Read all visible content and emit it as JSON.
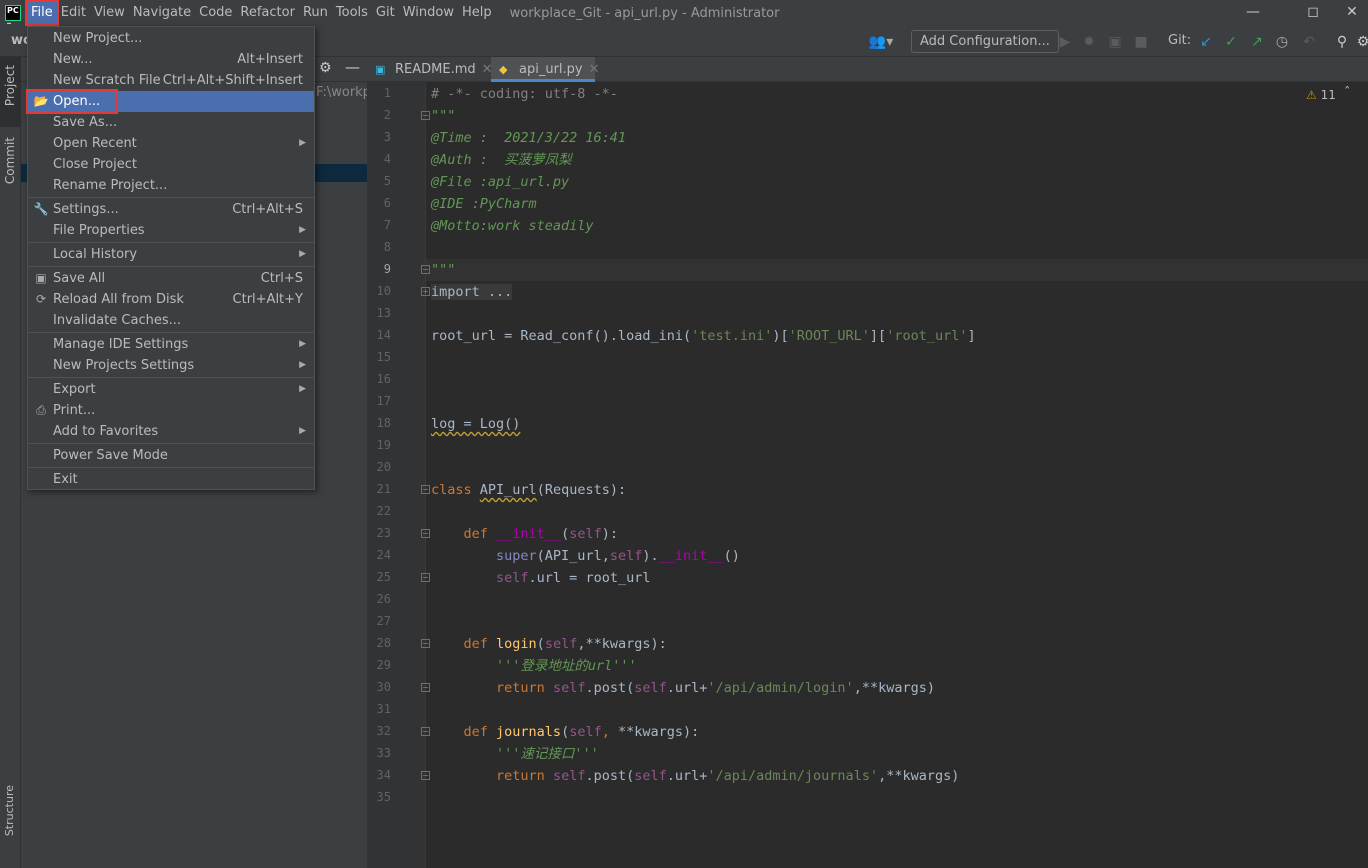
{
  "window": {
    "title": "workplace_Git - api_url.py - Administrator",
    "logo": "PC",
    "controls": [
      "minimize",
      "maximize",
      "close"
    ]
  },
  "menubar": [
    "File",
    "Edit",
    "View",
    "Navigate",
    "Code",
    "Refactor",
    "Run",
    "Tools",
    "Git",
    "Window",
    "Help"
  ],
  "menubar_active": "File",
  "toolbar": {
    "project_crumb": "wo",
    "add_configuration": "Add Configuration...",
    "git_label": "Git:",
    "icons": [
      "user-icon",
      "run-icon",
      "debug-icon",
      "coverage-icon",
      "stop-icon",
      "git-update-icon",
      "git-commit-icon",
      "git-push-icon",
      "history-icon",
      "rollback-icon",
      "search-icon",
      "settings-icon"
    ]
  },
  "side_strip": {
    "project": "Project",
    "commit": "Commit",
    "structure": "Structure"
  },
  "project_panel": {
    "path": "F:\\workp"
  },
  "tabs": [
    {
      "label": "README.md",
      "icon": "markdown-file-icon"
    },
    {
      "label": "api_url.py",
      "icon": "python-file-icon",
      "active": true
    }
  ],
  "editor": {
    "warnings": "11",
    "current_line": 9,
    "lines": [
      {
        "n": 1,
        "tokens": [
          [
            "# -*- coding: utf-8 -*-",
            "cm"
          ]
        ]
      },
      {
        "n": 2,
        "tokens": [
          [
            "\"\"\"",
            "doc"
          ]
        ]
      },
      {
        "n": 3,
        "tokens": [
          [
            "@Time :  2021/3/22 16:41",
            "doc"
          ]
        ]
      },
      {
        "n": 4,
        "tokens": [
          [
            "@Auth :  买菠萝凤梨",
            "doc"
          ]
        ]
      },
      {
        "n": 5,
        "tokens": [
          [
            "@File :api_url.py",
            "doc"
          ]
        ]
      },
      {
        "n": 6,
        "tokens": [
          [
            "@IDE :PyCharm",
            "doc"
          ]
        ]
      },
      {
        "n": 7,
        "tokens": [
          [
            "@Motto:work steadily",
            "doc"
          ]
        ]
      },
      {
        "n": 8,
        "tokens": []
      },
      {
        "n": 9,
        "tokens": [
          [
            "\"\"\"",
            "doc"
          ]
        ]
      },
      {
        "n": 10,
        "tokens": [
          [
            "import ...",
            "fold"
          ]
        ]
      },
      {
        "n": 13,
        "tokens": []
      },
      {
        "n": 14,
        "tokens": [
          [
            "root_url = Read_conf().load_ini(",
            ""
          ],
          [
            "'test.ini'",
            "str"
          ],
          [
            ")[",
            ""
          ],
          [
            "'ROOT_URL'",
            "str"
          ],
          [
            "][",
            ""
          ],
          [
            "'root_url'",
            "str"
          ],
          [
            "]",
            ""
          ]
        ]
      },
      {
        "n": 15,
        "tokens": []
      },
      {
        "n": 16,
        "tokens": []
      },
      {
        "n": 17,
        "tokens": []
      },
      {
        "n": 18,
        "tokens": [
          [
            "log = Log()",
            "w"
          ]
        ]
      },
      {
        "n": 19,
        "tokens": []
      },
      {
        "n": 20,
        "tokens": []
      },
      {
        "n": 21,
        "tokens": [
          [
            "class ",
            "kw"
          ],
          [
            "API_url",
            "w"
          ],
          [
            "(Requests):",
            ""
          ]
        ]
      },
      {
        "n": 22,
        "tokens": []
      },
      {
        "n": 23,
        "tokens": [
          [
            "    def ",
            "kw"
          ],
          [
            "__init__",
            "mg"
          ],
          [
            "(",
            ""
          ],
          [
            "self",
            "self"
          ],
          [
            "):",
            ""
          ]
        ]
      },
      {
        "n": 24,
        "tokens": [
          [
            "        ",
            ""
          ],
          [
            "super",
            "bi"
          ],
          [
            "(API_url,",
            ""
          ],
          [
            "self",
            "self"
          ],
          [
            ").",
            ""
          ],
          [
            "__init__",
            "mg"
          ],
          [
            "()",
            ""
          ]
        ]
      },
      {
        "n": 25,
        "tokens": [
          [
            "        ",
            ""
          ],
          [
            "self",
            "self"
          ],
          [
            ".url = root_url",
            ""
          ]
        ]
      },
      {
        "n": 26,
        "tokens": []
      },
      {
        "n": 27,
        "tokens": []
      },
      {
        "n": 28,
        "tokens": [
          [
            "    ",
            ""
          ],
          [
            "def ",
            "kw"
          ],
          [
            "login",
            "fn"
          ],
          [
            "(",
            ""
          ],
          [
            "self",
            "self"
          ],
          [
            ",**kwargs):",
            ""
          ]
        ]
      },
      {
        "n": 29,
        "tokens": [
          [
            "        ",
            ""
          ],
          [
            "'''登录地址的url'''",
            "doc"
          ]
        ]
      },
      {
        "n": 30,
        "tokens": [
          [
            "        ",
            ""
          ],
          [
            "return ",
            "kw"
          ],
          [
            "self",
            "self"
          ],
          [
            ".post(",
            ""
          ],
          [
            "self",
            "self"
          ],
          [
            ".url+",
            ""
          ],
          [
            "'/api/admin/login'",
            "str"
          ],
          [
            ",**kwargs)",
            ""
          ]
        ]
      },
      {
        "n": 31,
        "tokens": []
      },
      {
        "n": 32,
        "tokens": [
          [
            "    def ",
            "kw"
          ],
          [
            "journals",
            "fn"
          ],
          [
            "(",
            ""
          ],
          [
            "self",
            "self"
          ],
          [
            ", ",
            "kw"
          ],
          [
            "**kwargs):",
            ""
          ]
        ]
      },
      {
        "n": 33,
        "tokens": [
          [
            "        ",
            ""
          ],
          [
            "'''速记接口'''",
            "doc"
          ]
        ]
      },
      {
        "n": 34,
        "tokens": [
          [
            "        ",
            ""
          ],
          [
            "return ",
            "kw"
          ],
          [
            "self",
            "self"
          ],
          [
            ".post(",
            ""
          ],
          [
            "self",
            "self"
          ],
          [
            ".url+",
            ""
          ],
          [
            "'/api/admin/journals'",
            "str"
          ],
          [
            ",**kwargs)",
            ""
          ]
        ]
      },
      {
        "n": 35,
        "tokens": []
      }
    ]
  },
  "file_menu": [
    {
      "label": "New Project..."
    },
    {
      "label": "New...",
      "shortcut": "Alt+Insert"
    },
    {
      "label": "New Scratch File",
      "shortcut": "Ctrl+Alt+Shift+Insert"
    },
    {
      "label": "Open...",
      "icon": "folder-open-icon",
      "selected": true
    },
    {
      "label": "Save As..."
    },
    {
      "label": "Open Recent",
      "submenu": true
    },
    {
      "label": "Close Project"
    },
    {
      "label": "Rename Project...",
      "sep_after": true
    },
    {
      "label": "Settings...",
      "icon": "wrench-icon",
      "shortcut": "Ctrl+Alt+S"
    },
    {
      "label": "File Properties",
      "submenu": true,
      "sep_after": true
    },
    {
      "label": "Local History",
      "submenu": true,
      "sep_after": true
    },
    {
      "label": "Save All",
      "icon": "save-icon",
      "shortcut": "Ctrl+S"
    },
    {
      "label": "Reload All from Disk",
      "icon": "reload-icon",
      "shortcut": "Ctrl+Alt+Y"
    },
    {
      "label": "Invalidate Caches...",
      "sep_after": true
    },
    {
      "label": "Manage IDE Settings",
      "submenu": true
    },
    {
      "label": "New Projects Settings",
      "submenu": true,
      "sep_after": true
    },
    {
      "label": "Export",
      "submenu": true
    },
    {
      "label": "Print...",
      "icon": "print-icon"
    },
    {
      "label": "Add to Favorites",
      "submenu": true,
      "sep_after": true
    },
    {
      "label": "Power Save Mode",
      "sep_after": true
    },
    {
      "label": "Exit"
    }
  ]
}
